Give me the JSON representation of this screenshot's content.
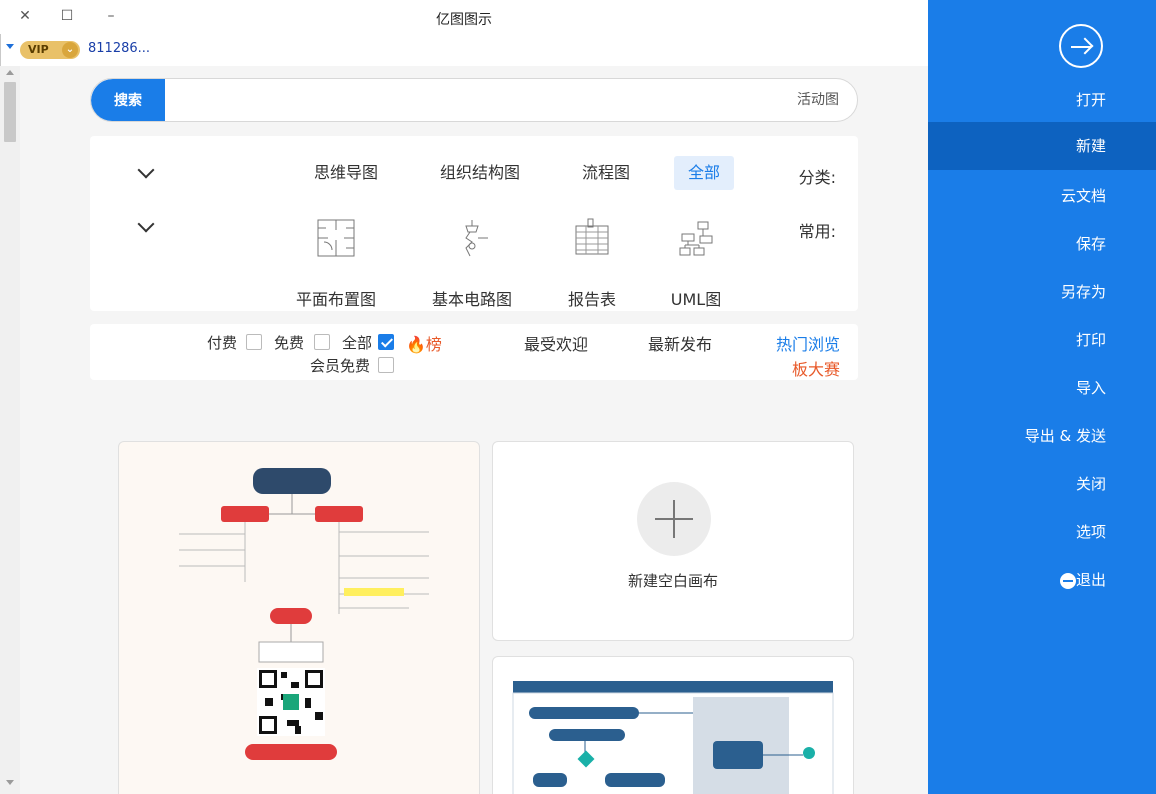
{
  "window": {
    "title": "亿图图示",
    "close": "✕",
    "maximize": "☐",
    "minimize": "–"
  },
  "account": {
    "vip_label": "VIP",
    "user": "811286..."
  },
  "search": {
    "button": "搜索",
    "value": "活动图"
  },
  "categories": {
    "label": "分类:",
    "items": [
      "全部",
      "流程图",
      "组织结构图",
      "思维导图"
    ],
    "selected": "全部"
  },
  "common": {
    "label": "常用:",
    "items": [
      {
        "label": "UML图",
        "icon": "uml-diagram-icon"
      },
      {
        "label": "报告表",
        "icon": "report-table-icon"
      },
      {
        "label": "基本电路图",
        "icon": "circuit-diagram-icon"
      },
      {
        "label": "平面布置图",
        "icon": "floor-plan-icon"
      }
    ]
  },
  "filters": {
    "tabs": [
      "热门浏览",
      "最新发布",
      "最受欢迎",
      "榜"
    ],
    "contest": "板大赛",
    "options": [
      {
        "label": "全部",
        "checked": true
      },
      {
        "label": "免费",
        "checked": false
      },
      {
        "label": "付费",
        "checked": false
      },
      {
        "label": "会员免费",
        "checked": false
      }
    ]
  },
  "templates": {
    "new_blank": "新建空白画布"
  },
  "sidebar": {
    "items": [
      "打开",
      "新建",
      "云文档",
      "保存",
      "另存为",
      "打印",
      "导入",
      "导出 & 发送",
      "关闭",
      "选项",
      "退出"
    ],
    "active": "新建"
  },
  "colors": {
    "accent": "#1a7de8",
    "sidebar_active": "#0d62c0",
    "hot": "#e85a2a"
  }
}
